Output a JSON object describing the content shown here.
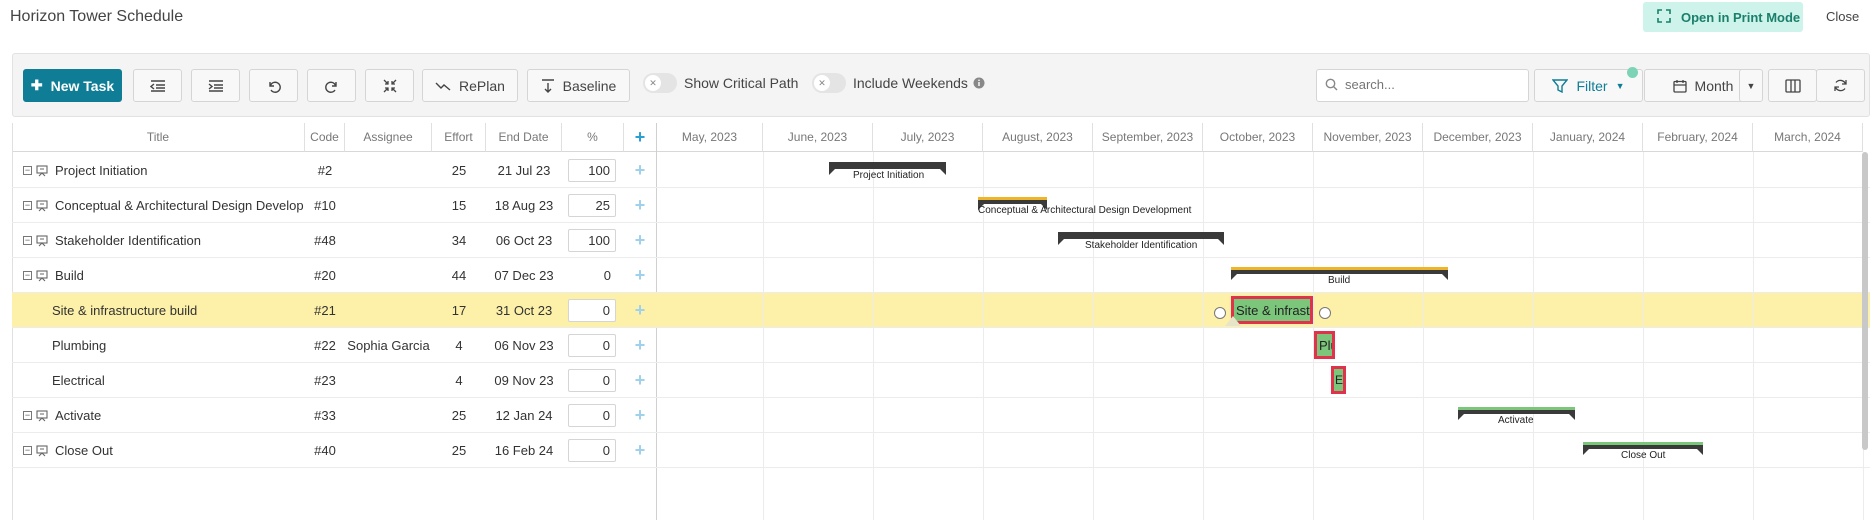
{
  "app": {
    "title": "Horizon Tower Schedule",
    "print_label": "Open in Print Mode",
    "close_label": "Close"
  },
  "toolbar": {
    "new_task": "New Task",
    "replan": "RePlan",
    "baseline": "Baseline",
    "show_critical_path": "Show Critical Path",
    "include_weekends": "Include Weekends",
    "search_placeholder": "search...",
    "filter": "Filter",
    "view": "Month"
  },
  "columns": {
    "title": "Title",
    "code": "Code",
    "assignee": "Assignee",
    "effort": "Effort",
    "end_date": "End Date",
    "pct": "%"
  },
  "months": [
    "May, 2023",
    "June, 2023",
    "July, 2023",
    "August, 2023",
    "September, 2023",
    "October, 2023",
    "November, 2023",
    "December, 2023",
    "January, 2024",
    "February, 2024",
    "March, 2024"
  ],
  "rows": [
    {
      "title": "Project Initiation",
      "code": "#2",
      "assignee": "",
      "effort": "25",
      "end_date": "21 Jul 23",
      "pct": "100",
      "summary": true,
      "pct_boxed": true
    },
    {
      "title": "Conceptual & Architectural Design Develop",
      "code": "#10",
      "assignee": "",
      "effort": "15",
      "end_date": "18 Aug 23",
      "pct": "25",
      "summary": true,
      "pct_boxed": true
    },
    {
      "title": "Stakeholder Identification",
      "code": "#48",
      "assignee": "",
      "effort": "34",
      "end_date": "06 Oct 23",
      "pct": "100",
      "summary": true,
      "pct_boxed": true
    },
    {
      "title": "Build",
      "code": "#20",
      "assignee": "",
      "effort": "44",
      "end_date": "07 Dec 23",
      "pct": "0",
      "summary": true,
      "pct_boxed": false
    },
    {
      "title": "Site & infrastructure build",
      "code": "#21",
      "assignee": "",
      "effort": "17",
      "end_date": "31 Oct 23",
      "pct": "0",
      "summary": false,
      "pct_boxed": true
    },
    {
      "title": "Plumbing",
      "code": "#22",
      "assignee": "Sophia Garcia",
      "effort": "4",
      "end_date": "06 Nov 23",
      "pct": "0",
      "summary": false,
      "pct_boxed": true
    },
    {
      "title": "Electrical",
      "code": "#23",
      "assignee": "",
      "effort": "4",
      "end_date": "09 Nov 23",
      "pct": "0",
      "summary": false,
      "pct_boxed": true
    },
    {
      "title": "Activate",
      "code": "#33",
      "assignee": "",
      "effort": "25",
      "end_date": "12 Jan 24",
      "pct": "0",
      "summary": true,
      "pct_boxed": true
    },
    {
      "title": "Close Out",
      "code": "#40",
      "assignee": "",
      "effort": "25",
      "end_date": "16 Feb 24",
      "pct": "0",
      "summary": true,
      "pct_boxed": true
    }
  ],
  "gantt": {
    "summary_labels": [
      "Project Initiation",
      "Conceptual & Architectural Design Development",
      "Stakeholder Identification",
      "Build",
      "Activate",
      "Close Out"
    ],
    "task_labels": [
      "Site & infrastru",
      "Plu",
      "E"
    ],
    "colors": {
      "summary": "#3a3a3a",
      "task_fill": "#7bc67b",
      "task_border": "#e0324a",
      "progress_yellow": "#f0b429",
      "progress_green": "#7bc67b",
      "selected_row": "#fdf0a8"
    }
  }
}
